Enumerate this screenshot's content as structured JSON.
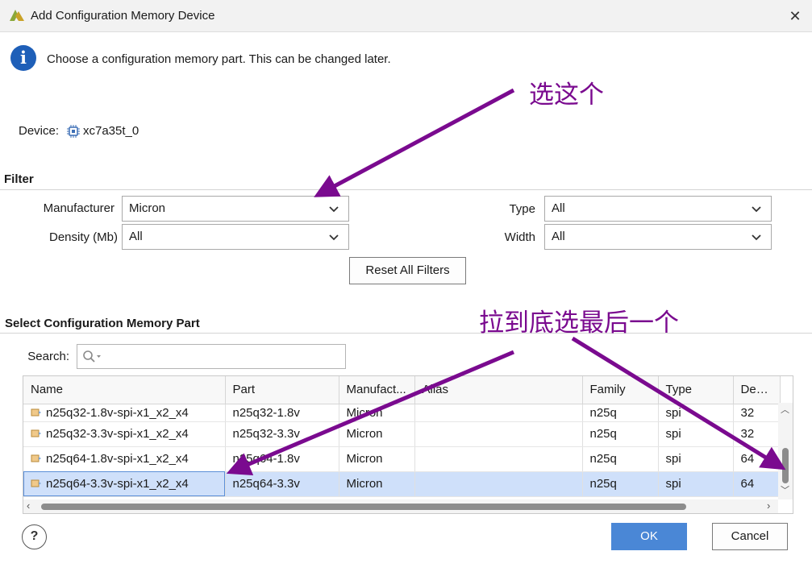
{
  "window": {
    "title": "Add Configuration Memory Device",
    "close_glyph": "✕"
  },
  "info": {
    "icon": "info-icon",
    "text": "Choose a configuration memory part. This can be changed later."
  },
  "device": {
    "label": "Device:",
    "value": "xc7a35t_0"
  },
  "filter": {
    "title": "Filter",
    "manufacturer": {
      "label": "Manufacturer",
      "value": "Micron"
    },
    "density": {
      "label": "Density (Mb)",
      "value": "All"
    },
    "type": {
      "label": "Type",
      "value": "All"
    },
    "width": {
      "label": "Width",
      "value": "All"
    },
    "reset_label": "Reset All Filters"
  },
  "select_part": {
    "title": "Select Configuration Memory Part",
    "search_label": "Search:",
    "search_value": ""
  },
  "table": {
    "headers": [
      "Name",
      "Part",
      "Manufact...",
      "Alias",
      "Family",
      "Type",
      "Densit"
    ],
    "rows": [
      {
        "name": "n25q32-1.8v-spi-x1_x2_x4",
        "part": "n25q32-1.8v",
        "manufacturer": "Micron",
        "alias": "",
        "family": "n25q",
        "type": "spi",
        "density": "32"
      },
      {
        "name": "n25q32-3.3v-spi-x1_x2_x4",
        "part": "n25q32-3.3v",
        "manufacturer": "Micron",
        "alias": "",
        "family": "n25q",
        "type": "spi",
        "density": "32"
      },
      {
        "name": "n25q64-1.8v-spi-x1_x2_x4",
        "part": "n25q64-1.8v",
        "manufacturer": "Micron",
        "alias": "",
        "family": "n25q",
        "type": "spi",
        "density": "64"
      },
      {
        "name": "n25q64-3.3v-spi-x1_x2_x4",
        "part": "n25q64-3.3v",
        "manufacturer": "Micron",
        "alias": "",
        "family": "n25q",
        "type": "spi",
        "density": "64"
      }
    ],
    "selected_index": 3
  },
  "buttons": {
    "help": "?",
    "ok": "OK",
    "cancel": "Cancel"
  },
  "annotations": {
    "pick_this": "选这个",
    "scroll_pick_last": "拉到底选最后一个"
  },
  "colors": {
    "accent": "#4a87d6",
    "annotation": "#7a0a8f",
    "selection": "#cfe0fa"
  }
}
